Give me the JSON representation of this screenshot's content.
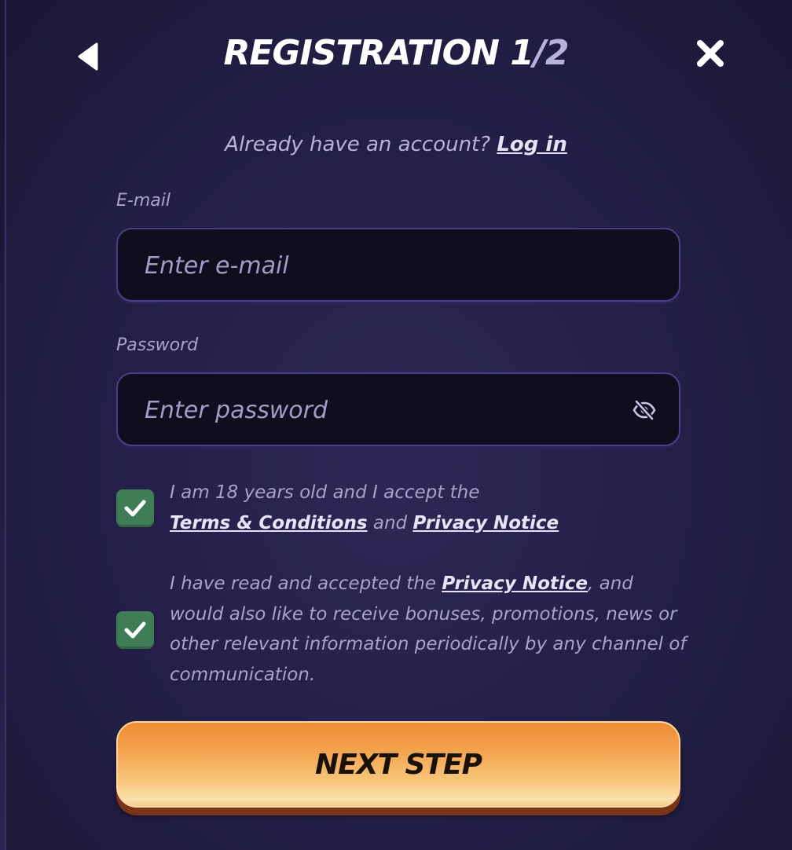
{
  "header": {
    "title_main": "REGISTRATION ",
    "step_current": "1",
    "step_separator": "/",
    "step_total": "2",
    "back_icon": "back-triangle-icon",
    "close_icon": "close-x-icon"
  },
  "login_prompt": {
    "text": "Already have an account?",
    "link": "Log in"
  },
  "email": {
    "label": "E-mail",
    "placeholder": "Enter e-mail",
    "value": ""
  },
  "password": {
    "label": "Password",
    "placeholder": "Enter password",
    "value": "",
    "toggle_icon": "eye-slash-icon"
  },
  "consents": [
    {
      "checked": true,
      "text_before": "I am 18 years old and I accept the ",
      "link1": "Terms & Conditions",
      "text_middle": " and ",
      "link2": "Privacy Notice"
    },
    {
      "checked": true,
      "text_before": "I have read and accepted the ",
      "link": "Privacy Notice",
      "text_after": ", and would also like to receive bonuses, promotions, news or other relevant information periodically by any channel of communication."
    }
  ],
  "next_button": {
    "label": "NEXT STEP"
  },
  "colors": {
    "checkbox_green": "#3f7d57",
    "button_orange_top": "#ef8c36",
    "button_orange_bottom": "#fbe2ac",
    "modal_background": "#24204a",
    "input_background": "#0f0e1e",
    "input_border": "#4b3f86"
  }
}
